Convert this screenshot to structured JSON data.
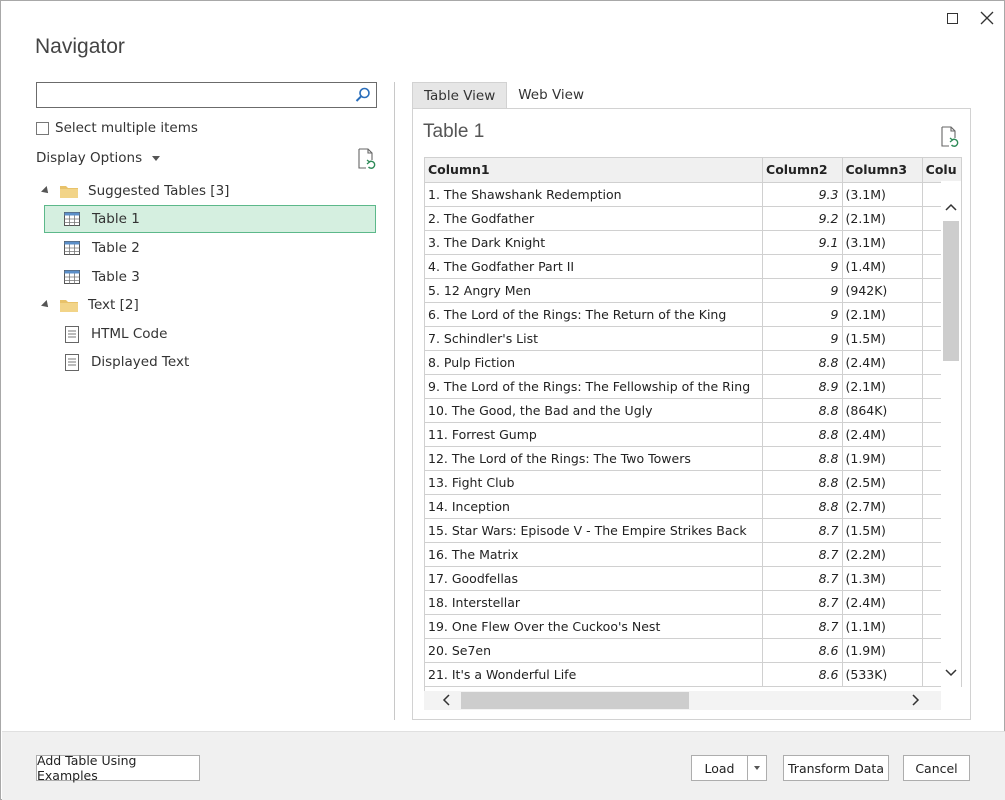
{
  "window": {
    "title": "Navigator"
  },
  "search": {
    "placeholder": "",
    "value": ""
  },
  "select_multiple_label": "Select multiple items",
  "display_options_label": "Display Options",
  "tree": {
    "suggested_tables": {
      "label": "Suggested Tables [3]",
      "items": [
        "Table 1",
        "Table 2",
        "Table 3"
      ]
    },
    "text": {
      "label": "Text [2]",
      "items": [
        "HTML Code",
        "Displayed Text"
      ]
    }
  },
  "tabs": [
    "Table View",
    "Web View"
  ],
  "preview": {
    "title": "Table 1",
    "columns": [
      "Column1",
      "Column2",
      "Column3",
      "Colu"
    ],
    "rows": [
      [
        "1. The Shawshank Redemption",
        "9.3",
        "(3.1M)"
      ],
      [
        "2. The Godfather",
        "9.2",
        "(2.1M)"
      ],
      [
        "3. The Dark Knight",
        "9.1",
        "(3.1M)"
      ],
      [
        "4. The Godfather Part II",
        "9",
        "(1.4M)"
      ],
      [
        "5. 12 Angry Men",
        "9",
        "(942K)"
      ],
      [
        "6. The Lord of the Rings: The Return of the King",
        "9",
        "(2.1M)"
      ],
      [
        "7. Schindler's List",
        "9",
        "(1.5M)"
      ],
      [
        "8. Pulp Fiction",
        "8.8",
        "(2.4M)"
      ],
      [
        "9. The Lord of the Rings: The Fellowship of the Ring",
        "8.9",
        "(2.1M)"
      ],
      [
        "10. The Good, the Bad and the Ugly",
        "8.8",
        "(864K)"
      ],
      [
        "11. Forrest Gump",
        "8.8",
        "(2.4M)"
      ],
      [
        "12. The Lord of the Rings: The Two Towers",
        "8.8",
        "(1.9M)"
      ],
      [
        "13. Fight Club",
        "8.8",
        "(2.5M)"
      ],
      [
        "14. Inception",
        "8.8",
        "(2.7M)"
      ],
      [
        "15. Star Wars: Episode V - The Empire Strikes Back",
        "8.7",
        "(1.5M)"
      ],
      [
        "16. The Matrix",
        "8.7",
        "(2.2M)"
      ],
      [
        "17. Goodfellas",
        "8.7",
        "(1.3M)"
      ],
      [
        "18. Interstellar",
        "8.7",
        "(2.4M)"
      ],
      [
        "19. One Flew Over the Cuckoo's Nest",
        "8.7",
        "(1.1M)"
      ],
      [
        "20. Se7en",
        "8.6",
        "(1.9M)"
      ],
      [
        "21. It's a Wonderful Life",
        "8.6",
        "(533K)"
      ]
    ]
  },
  "footer": {
    "add_table_label": "Add Table Using Examples",
    "load_label": "Load",
    "transform_label": "Transform Data",
    "cancel_label": "Cancel"
  },
  "icons": {
    "search": "search-icon",
    "refresh": "refresh-document-icon",
    "folder": "folder-icon",
    "table": "table-icon",
    "document": "document-icon"
  },
  "colors": {
    "selected_bg": "#d5efe0",
    "selected_border": "#5cb88a"
  }
}
